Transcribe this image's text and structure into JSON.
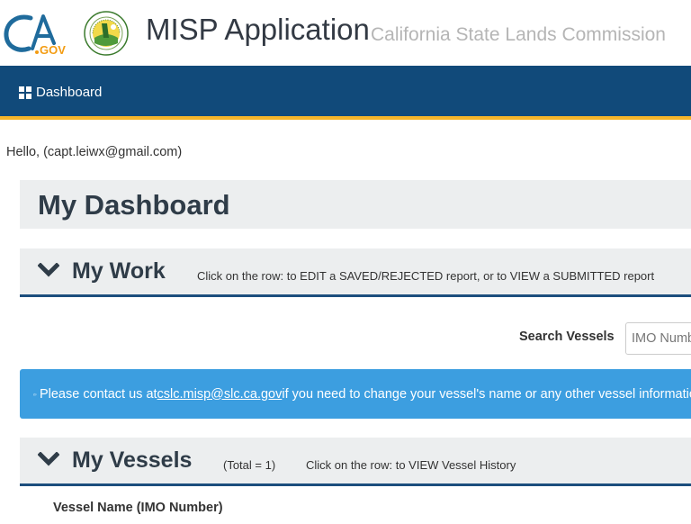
{
  "header": {
    "cagov_logo_text": "CA.GOV",
    "seal_text": "California State Lands Commission",
    "app_title": "MISP Application",
    "app_subtitle": "California State Lands Commission"
  },
  "nav": {
    "items": [
      {
        "label": "Dashboard",
        "icon": "dashboard-grid-icon"
      }
    ]
  },
  "greeting": "Hello, (capt.leiwx@gmail.com)",
  "dashboard": {
    "title": "My Dashboard"
  },
  "my_work": {
    "title": "My Work",
    "hint": "Click on the row: to EDIT a SAVED/REJECTED report, or to VIEW a SUBMITTED report"
  },
  "search": {
    "label": "Search Vessels",
    "placeholder": "IMO Number",
    "value": ""
  },
  "alert": {
    "prefix": "Please contact us at ",
    "email": "cslc.misp@slc.ca.gov",
    "suffix": " if you need to change your vessel's name or any other vessel information"
  },
  "my_vessels": {
    "title": "My Vessels",
    "total": "(Total = 1)",
    "hint": "Click on the row: to VIEW Vessel History"
  },
  "vessels_table": {
    "columns": [
      "Vessel Name (IMO Number)"
    ]
  },
  "colors": {
    "navbar": "#114a7a",
    "navbar_accent": "#f5b52a",
    "alert": "#3c9ee0",
    "panel": "#eceeef",
    "section_border": "#1c4e7d",
    "cagov_blue": "#1f6b9c",
    "cagov_orange": "#f39c12"
  }
}
